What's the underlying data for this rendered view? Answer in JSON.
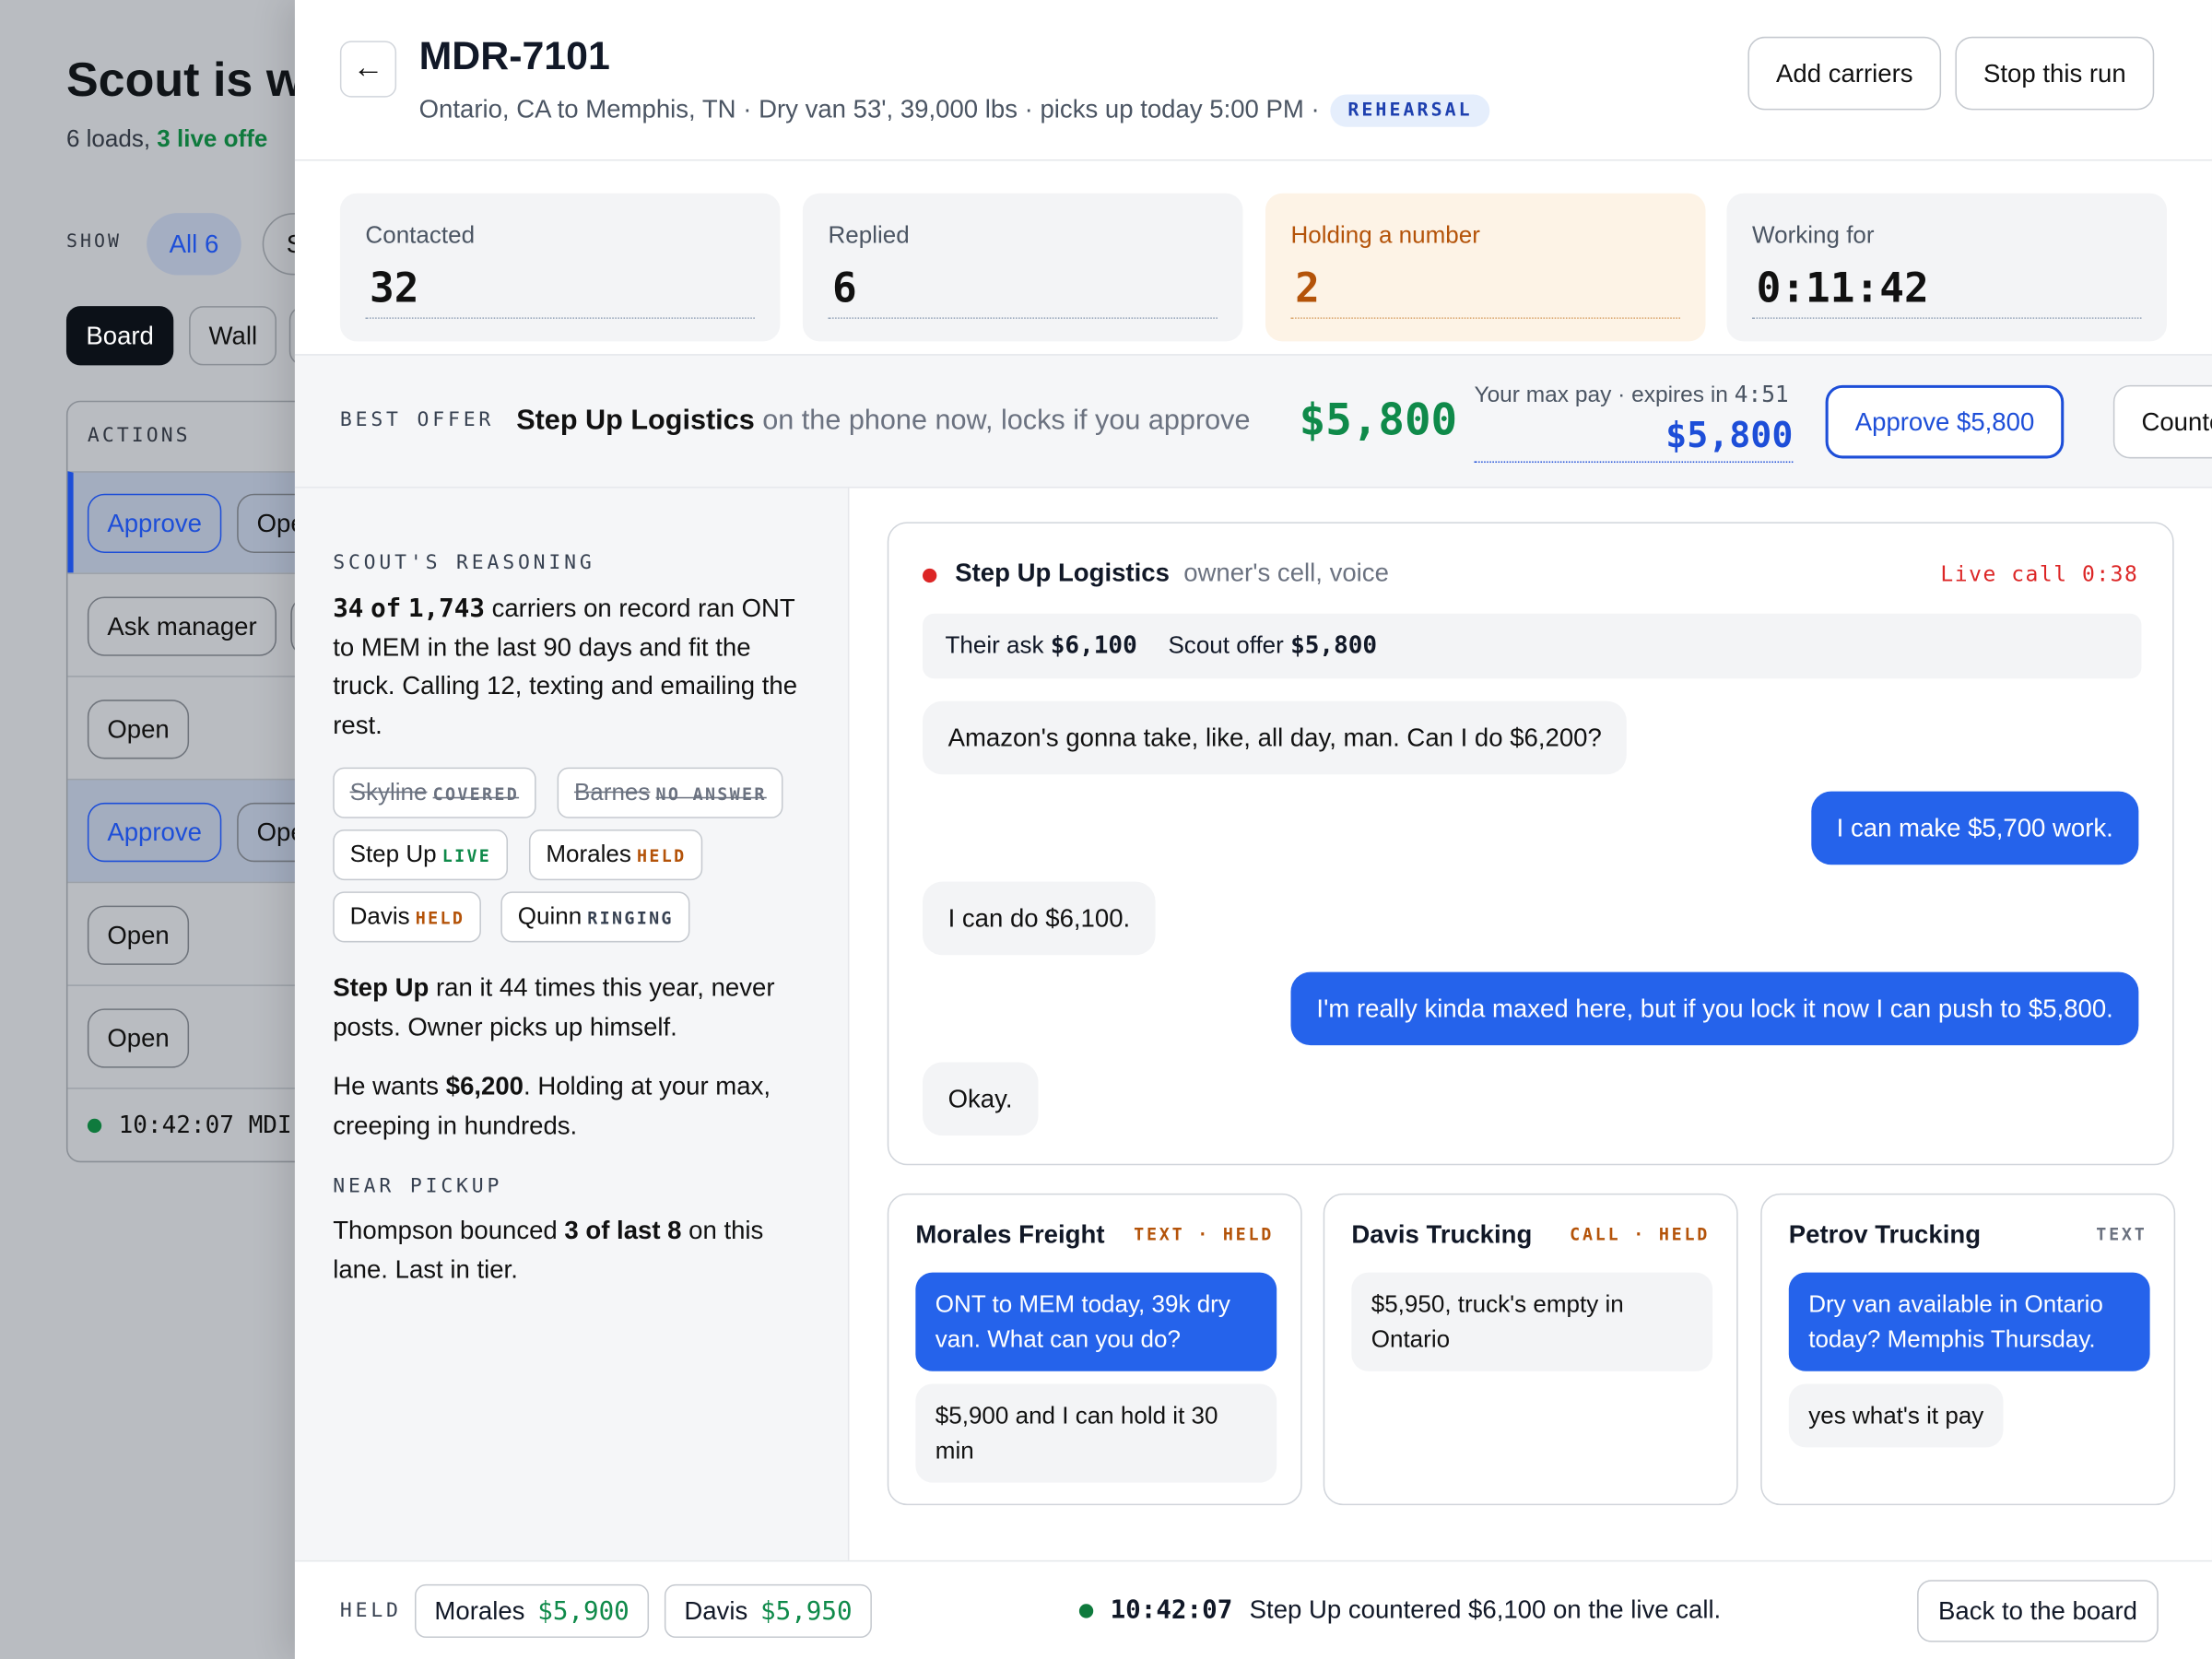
{
  "background": {
    "title": "Scout is w",
    "subtitle_prefix": "6 loads, ",
    "subtitle_live": "3 live offe",
    "show_label": "SHOW",
    "filter_all": "All 6",
    "filter_second": "S",
    "view_board": "Board",
    "view_wall": "Wall",
    "actions_label": "ACTIONS",
    "rows": [
      {
        "primary": "Approve",
        "secondary": "Ope"
      },
      {
        "primary": "Ask manager"
      },
      {
        "primary": "Open"
      },
      {
        "primary": "Approve",
        "secondary": "Ope"
      },
      {
        "primary": "Open"
      },
      {
        "primary": "Open"
      }
    ],
    "footer_time": "10:42:07",
    "footer_text": "MDI"
  },
  "header": {
    "back_glyph": "←",
    "load_id": "MDR-7101",
    "route": "Ontario, CA to Memphis, TN · Dry van 53', 39,000 lbs · picks up today 5:00 PM ·",
    "mode_badge": "REHEARSAL",
    "add_carriers": "Add carriers",
    "stop_run": "Stop this run"
  },
  "stats": [
    {
      "label": "Contacted",
      "value": "32"
    },
    {
      "label": "Replied",
      "value": "6"
    },
    {
      "label": "Holding a number",
      "value": "2"
    },
    {
      "label": "Working for",
      "value": "0:11:42"
    }
  ],
  "best_offer": {
    "label": "BEST OFFER",
    "carrier": "Step Up Logistics",
    "status": "on the phone now, locks if you approve",
    "price": "$5,800",
    "max_pay_label": "Your max pay · expires in ",
    "expires": "4:51",
    "max_pay": "$5,800",
    "approve_label": "Approve $5,800",
    "counter_label": "Counter"
  },
  "reasoning": {
    "label": "SCOUT'S REASONING",
    "count_hit": "34",
    "count_of": "of",
    "count_total": "1,743",
    "summary": "carriers on record ran ONT to MEM in the last 90 days and fit the truck. Calling 12, texting and emailing the rest.",
    "chips": [
      {
        "name": "Skyline",
        "tag": "COVERED"
      },
      {
        "name": "Barnes",
        "tag": "NO ANSWER"
      },
      {
        "name": "Step Up",
        "tag": "LIVE"
      },
      {
        "name": "Morales",
        "tag": "HELD"
      },
      {
        "name": "Davis",
        "tag": "HELD"
      },
      {
        "name": "Quinn",
        "tag": "RINGING"
      }
    ],
    "note1_bold": "Step Up",
    "note1_rest": " ran it 44 times this year, never posts. Owner picks up himself.",
    "note2_pre": "He wants ",
    "note2_bold": "$6,200",
    "note2_rest": ". Holding at your max, creeping in hundreds.",
    "near_label": "NEAR PICKUP",
    "near_pre": "Thompson bounced ",
    "near_bold": "3 of last 8",
    "near_rest": " on this lane. Last in tier."
  },
  "live_call": {
    "carrier": "Step Up Logistics",
    "channel": "owner's cell, voice",
    "status": "Live call 0:38",
    "ask_label": "Their ask",
    "ask_value": "$6,100",
    "offer_label": "Scout offer",
    "offer_value": "$5,800",
    "messages": [
      {
        "from": "them",
        "text": "Amazon's gonna take, like, all day, man. Can I do $6,200?"
      },
      {
        "from": "us",
        "text": "I can make $5,700 work."
      },
      {
        "from": "them",
        "text": "I can do $6,100."
      },
      {
        "from": "us",
        "text": "I'm really kinda maxed here, but if you lock it now I can push to $5,800."
      },
      {
        "from": "them",
        "text": "Okay."
      }
    ]
  },
  "threads": [
    {
      "carrier": "Morales Freight",
      "tag": "TEXT · HELD",
      "messages": [
        {
          "from": "us",
          "text": "ONT to MEM today, 39k dry van. What can you do?"
        },
        {
          "from": "them",
          "text": "$5,900 and I can hold it 30 min"
        }
      ]
    },
    {
      "carrier": "Davis Trucking",
      "tag": "CALL · HELD",
      "messages": [
        {
          "from": "them",
          "text": "$5,950, truck's empty in Ontario"
        }
      ]
    },
    {
      "carrier": "Petrov Trucking",
      "tag": "TEXT",
      "messages": [
        {
          "from": "us",
          "text": "Dry van available in Ontario today? Memphis Thursday."
        },
        {
          "from": "them",
          "text": "yes what's it pay"
        }
      ]
    }
  ],
  "footer": {
    "held_label": "HELD",
    "held": [
      {
        "name": "Morales",
        "price": "$5,900"
      },
      {
        "name": "Davis",
        "price": "$5,950"
      }
    ],
    "event_time": "10:42:07",
    "event_text": "Step Up countered $6,100 on the live call.",
    "back_label": "Back to the board"
  },
  "colors": {
    "accent": "#2563eb",
    "success": "#0f8a4a",
    "warning": "#b45309",
    "danger": "#dc2626"
  }
}
